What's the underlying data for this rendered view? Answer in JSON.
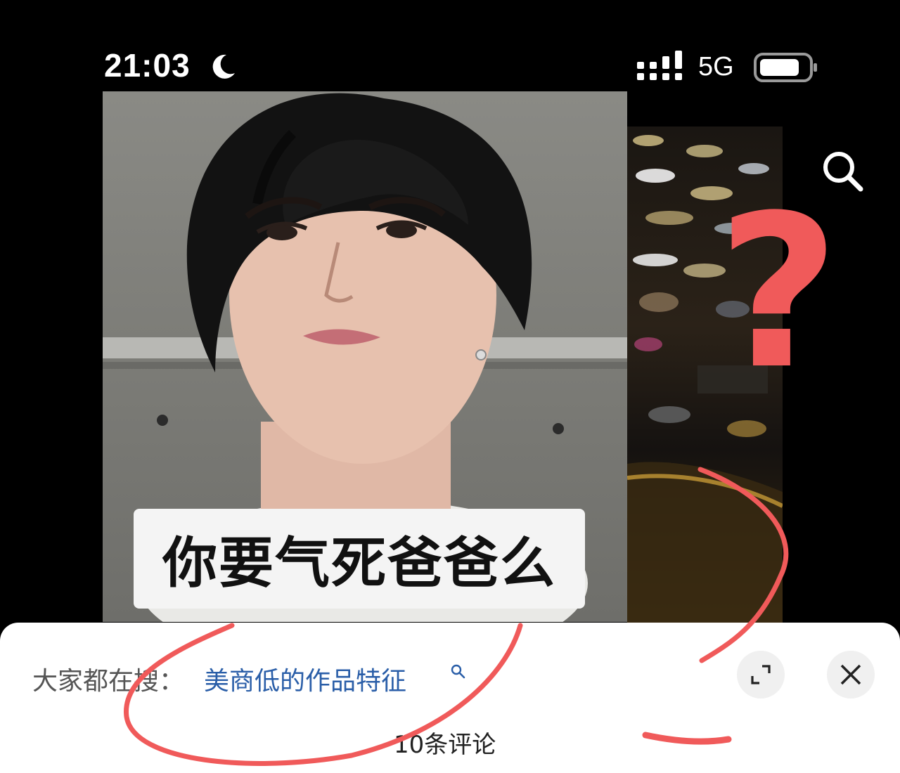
{
  "status_bar": {
    "time": "21:03",
    "network": "5G",
    "icons": [
      "moon-icon",
      "signal-icon",
      "battery-icon"
    ]
  },
  "video": {
    "caption": "你要气死爸爸么"
  },
  "top_right": {
    "icon": "search-icon"
  },
  "comment_sheet": {
    "trending_prefix": "大家都在搜：",
    "trending_query": "美商低的作品特征",
    "comment_count": "10条评论",
    "icons": [
      "expand-icon",
      "close-icon"
    ]
  },
  "annotations": {
    "question_mark": "?",
    "stroke_color": "#f05a5a"
  },
  "colors": {
    "background": "#000000",
    "sheet": "#ffffff",
    "link": "#2a5ea8",
    "annotation": "#f05a5a"
  }
}
